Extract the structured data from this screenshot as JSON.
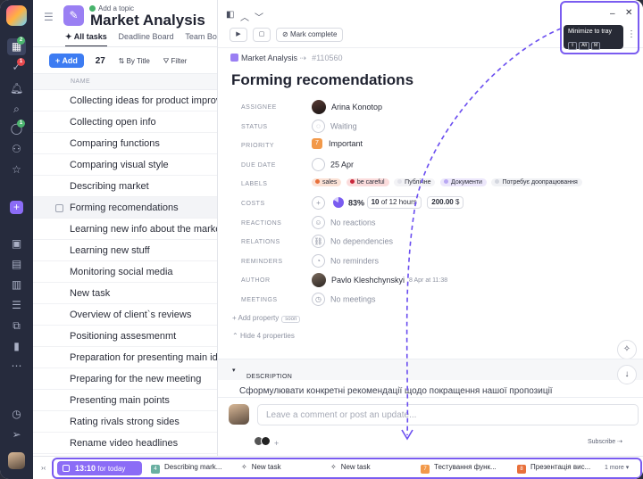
{
  "sidebar": {
    "badge_tasks": "1",
    "badge_inbox": "1",
    "badge_chat": "2"
  },
  "list": {
    "add_topic": "Add a topic",
    "project_title": "Market Analysis",
    "tabs": [
      "All tasks",
      "Deadline Board",
      "Team Board"
    ],
    "add_label": "Add",
    "count": "27",
    "sort_label": "By Title",
    "filter_label": "Filter",
    "column_name": "NAME",
    "rows": [
      "Collecting ideas for product improv",
      "Collecting open info",
      "Comparing functions",
      "Comparing visual style",
      "Describing market",
      "Forming recomendations",
      "Learning new info about the market",
      "Learning new stuff",
      "Monitoring social media",
      "New task",
      "Overview of client`s reviews",
      "Positioning assesmenmt",
      "Preparation for presenting main ide",
      "Preparing for the new meeting",
      "Presenting main points",
      "Rating rivals strong sides",
      "Rename video headlines"
    ]
  },
  "detail": {
    "mark_complete": "Mark complete",
    "breadcrumb_project": "Market Analysis",
    "breadcrumb_id": "#110560",
    "title": "Forming recomendations",
    "props": {
      "assignee": {
        "label": "ASSIGNEE",
        "value": "Arina Konotop"
      },
      "status": {
        "label": "STATUS",
        "value": "Waiting"
      },
      "priority": {
        "label": "PRIORITY",
        "value": "Important",
        "badge": "7"
      },
      "due_date": {
        "label": "DUE DATE",
        "value": "25 Apr"
      },
      "labels": {
        "label": "LABELS",
        "items": [
          "sales",
          "be careful",
          "Публічне",
          "Документи",
          "Потребує доопрацювання"
        ]
      },
      "costs": {
        "label": "COSTS",
        "percent": "83%",
        "hours_done": "10",
        "hours_text": "of 12 hours",
        "money": "200.00",
        "currency": "$"
      },
      "reactions": {
        "label": "REACTIONS",
        "value": "No reactions"
      },
      "relations": {
        "label": "RELATIONS",
        "value": "No dependencies"
      },
      "reminders": {
        "label": "REMINDERS",
        "value": "No reminders"
      },
      "author": {
        "label": "AUTHOR",
        "value": "Pavlo Kleshchynskyi",
        "meta": "8 Apr at 11:38"
      },
      "meetings": {
        "label": "MEETINGS",
        "value": "No meetings"
      }
    },
    "add_property": "Add property",
    "soon": "soon",
    "hide_props": "Hide 4 properties",
    "description_label": "DESCRIPTION",
    "description_text": "Сформулювати конкретні рекомендації щодо покращення нашої пропозиції",
    "comment_placeholder": "Leave a comment or post an update...",
    "subscribe": "Subscribe"
  },
  "tooltip": {
    "text": "Minimize to tray",
    "keys": [
      "⇧",
      "Alt",
      "M"
    ]
  },
  "tray": {
    "timer_time": "13:10",
    "timer_text": "for today",
    "items": [
      {
        "badge": "4",
        "label": "Describing mark...",
        "color": "#6bb0a2"
      },
      {
        "badge": "",
        "label": "New task",
        "color": ""
      },
      {
        "badge": "",
        "label": "New task",
        "color": ""
      },
      {
        "badge": "7",
        "label": "Тестування функ...",
        "color": "#f2994a"
      },
      {
        "badge": "8",
        "label": "Презентація вис...",
        "color": "#e8703a"
      }
    ],
    "more": "1 more"
  },
  "colors": {
    "accent": "#7a5cf0",
    "primary_button": "#3d7cf2",
    "sidebar_bg": "#262b3d"
  }
}
